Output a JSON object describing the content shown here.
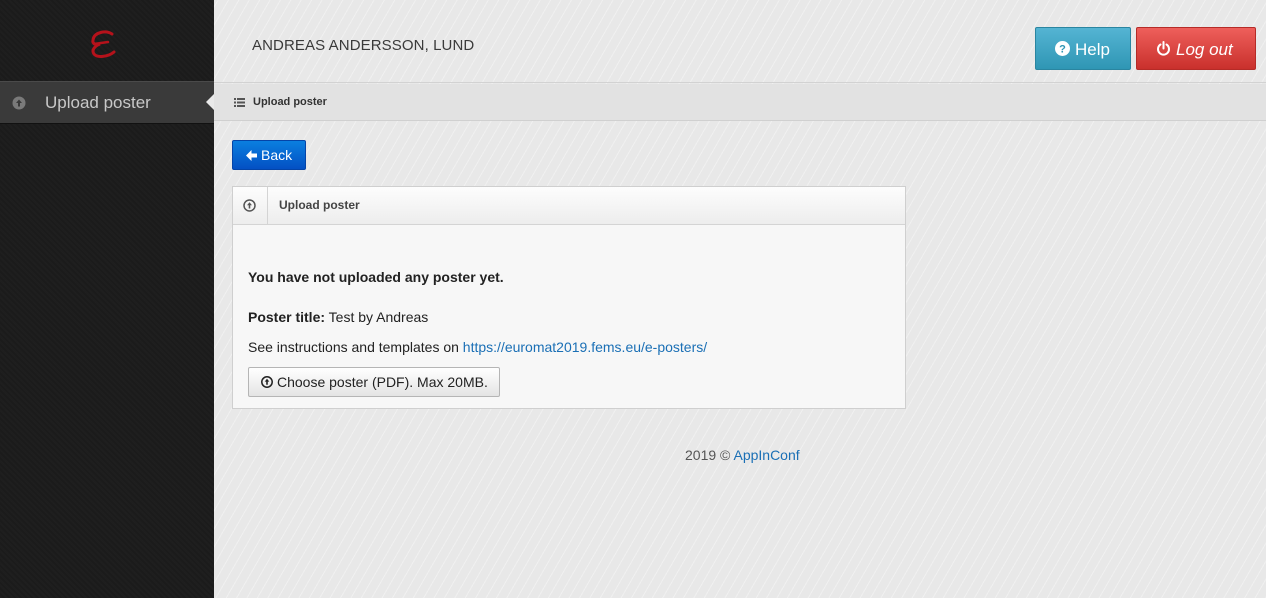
{
  "sidebar": {
    "logo_icon": "stylized-e-logo",
    "items": [
      {
        "label": "Upload poster",
        "icon": "upload-circle-icon"
      }
    ]
  },
  "header": {
    "user_name": "ANDREAS ANDERSSON, LUND",
    "help_label": "Help",
    "logout_label": "Log out"
  },
  "breadcrumb": {
    "label": "Upload poster",
    "icon": "list-icon"
  },
  "back_button": {
    "label": "Back"
  },
  "panel": {
    "title": "Upload poster",
    "message": "You have not uploaded any poster yet.",
    "poster_title_label": "Poster title:",
    "poster_title_value": "Test by Andreas",
    "instructions_text": "See instructions and templates on",
    "instructions_link": "https://euromat2019.fems.eu/e-posters/",
    "choose_button_label": "Choose poster (PDF). Max 20MB."
  },
  "footer": {
    "copyright": "2019 ©",
    "link_label": "AppInConf"
  },
  "colors": {
    "help": "#2f96b4",
    "logout": "#c9302c",
    "back": "#0350c4",
    "link": "#1a6fb5",
    "logo": "#b5121b"
  }
}
